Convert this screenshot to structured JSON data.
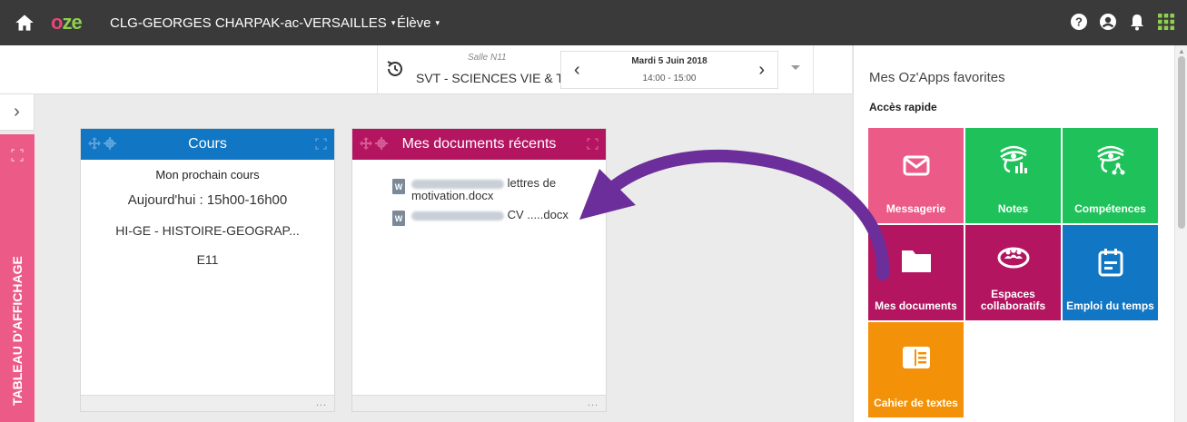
{
  "topbar": {
    "logo_o": "o",
    "logo_ze": "ze",
    "school": "CLG-GEORGES CHARPAK-ac-VERSAILLES",
    "role": "Élève",
    "caret": "▾",
    "icons": [
      "home-icon",
      "help-icon",
      "user-icon",
      "bell-icon",
      "apps-grid-icon"
    ]
  },
  "schedule": {
    "room": "Salle N11",
    "course": "SVT - SCIENCES VIE & TE...",
    "date": "Mardi 5 Juin 2018",
    "time": "14:00 - 15:00",
    "prev": "‹",
    "next": "›"
  },
  "sidebar": {
    "toggle": "›",
    "tab_label": "TABLEAU D'AFFICHAGE"
  },
  "widgets": {
    "cours": {
      "title": "Cours",
      "next_label": "Mon prochain cours",
      "when": "Aujourd'hui : 15h00-16h00",
      "subject": "HI-GE - HISTOIRE-GEOGRAP...",
      "room": "E11",
      "more": "..."
    },
    "docs": {
      "title": "Mes documents récents",
      "items": [
        {
          "text_a": "lettres de",
          "text_b": "motivation.docx"
        },
        {
          "text_a": "CV .....docx"
        }
      ],
      "file_badge": "W",
      "more": "..."
    }
  },
  "favorites": {
    "title": "Mes Oz'Apps favorites",
    "subtitle": "Accès rapide",
    "tiles": [
      {
        "label": "Messagerie",
        "color": "#ec5b87",
        "icon": "envelope-icon"
      },
      {
        "label": "Notes",
        "color": "#1fc25a",
        "icon": "eye-chart-icon"
      },
      {
        "label": "Compétences",
        "color": "#1fc25a",
        "icon": "eye-network-icon"
      },
      {
        "label": "Mes documents",
        "color": "#b31560",
        "icon": "folder-icon"
      },
      {
        "label": "Espaces collaboratifs",
        "color": "#b31560",
        "icon": "people-circle-icon"
      },
      {
        "label": "Emploi du temps",
        "color": "#1176c3",
        "icon": "calendar-icon"
      },
      {
        "label": "Cahier de textes",
        "color": "#f39208",
        "icon": "notebook-icon"
      }
    ]
  },
  "colors": {
    "topbar": "#3a3a3a",
    "accent_pink": "#ec5b87",
    "arrow": "#6b2e9a"
  }
}
